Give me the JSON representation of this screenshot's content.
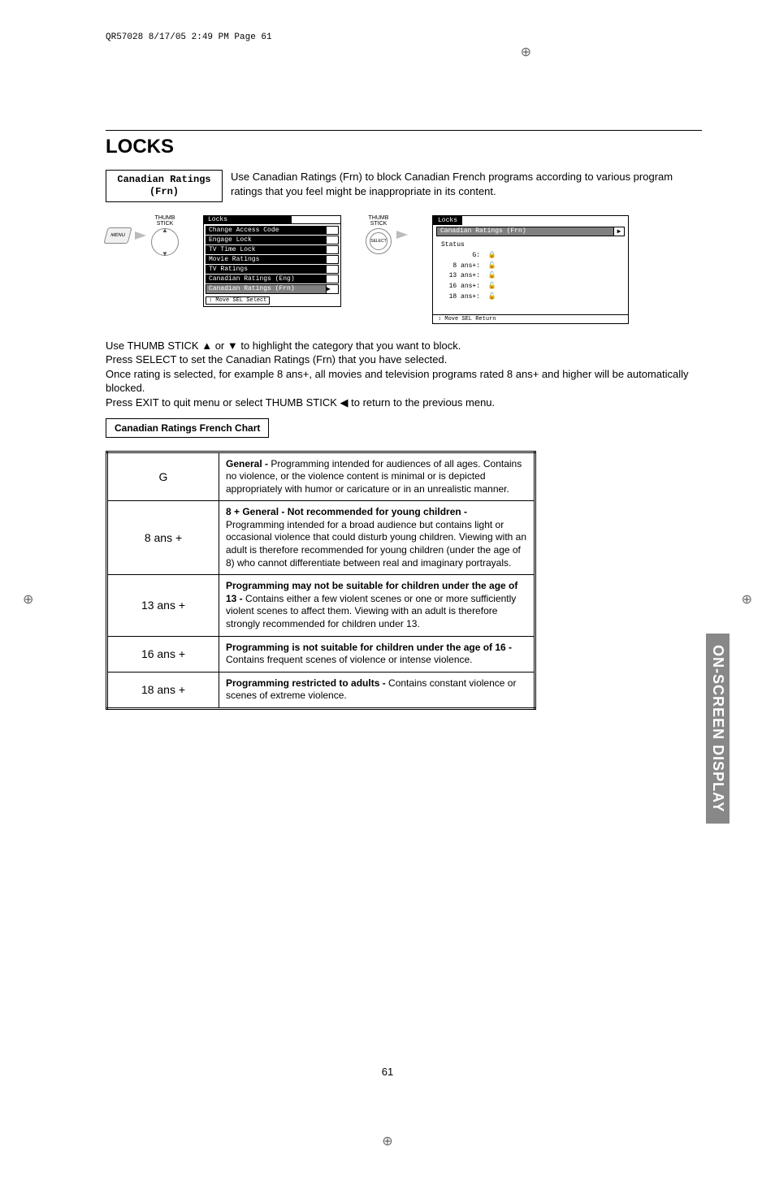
{
  "header_line": "QR57028  8/17/05  2:49 PM  Page 61",
  "section_title": "LOCKS",
  "feature_label": "Canadian Ratings\n(Frn)",
  "feature_desc": "Use Canadian Ratings (Frn) to block Canadian French programs according to various program ratings that you feel might be inappropriate in its content.",
  "menu_btn": "MENU",
  "thumbstick_label": "THUMB\nSTICK",
  "select_label": "SELECT",
  "osd1": {
    "title": "Locks",
    "items": [
      "Change Access Code",
      "Engage Lock",
      "TV Time Lock",
      "Movie Ratings",
      "TV Ratings",
      "Canadian Ratings (Eng)",
      "Canadian Ratings (Frn)"
    ],
    "highlight_index": 6,
    "nav": "Move  SEL Select"
  },
  "osd2": {
    "title": "Locks",
    "sub": "Canadian Ratings (Frn)",
    "status_label": "Status",
    "rows": [
      {
        "label": "G:",
        "locked": true
      },
      {
        "label": "8 ans+:",
        "locked": false
      },
      {
        "label": "13 ans+:",
        "locked": false
      },
      {
        "label": "16 ans+:",
        "locked": false
      },
      {
        "label": "18 ans+:",
        "locked": false
      }
    ],
    "nav": "Move  SEL Return"
  },
  "instructions": {
    "l1": "Use THUMB STICK ▲ or ▼ to highlight the category that you want to block.",
    "l2": "Press SELECT to set the Canadian Ratings (Frn) that you have selected.",
    "l3": "Once rating is selected, for example 8 ans+, all movies and television programs rated 8 ans+ and higher will be automatically blocked.",
    "l4": "Press EXIT to quit menu or select THUMB STICK ◀ to return to the previous menu."
  },
  "subchart_title": "Canadian Ratings French Chart",
  "ratings": [
    {
      "code": "G",
      "bold": "General -",
      "text": " Programming intended for audiences of all ages.  Contains no violence, or the violence content is minimal or is depicted appropriately with humor or caricature or in an unrealistic manner."
    },
    {
      "code": "8 ans +",
      "bold": "8 + General - Not recommended for young children -",
      "text": "  Programming intended for a broad audience but contains light or occasional violence that could disturb young children.  Viewing with an adult is therefore recommended for young children (under the age of 8) who cannot differentiate between real and imaginary portrayals."
    },
    {
      "code": "13 ans +",
      "bold": "Programming may not be suitable for children under the age of 13 -",
      "text": " Contains either a few violent scenes or one or more sufficiently violent scenes to affect them.  Viewing with an adult is therefore strongly recommended for children under 13."
    },
    {
      "code": "16 ans +",
      "bold": "Programming is not suitable for children under the age of 16 -",
      "text": " Contains frequent scenes of violence or intense violence."
    },
    {
      "code": "18 ans +",
      "bold": "Programming restricted to adults -",
      "text": "  Contains constant violence or scenes of extreme violence."
    }
  ],
  "side_tab": "ON-SCREEN DISPLAY",
  "page_number": "61"
}
